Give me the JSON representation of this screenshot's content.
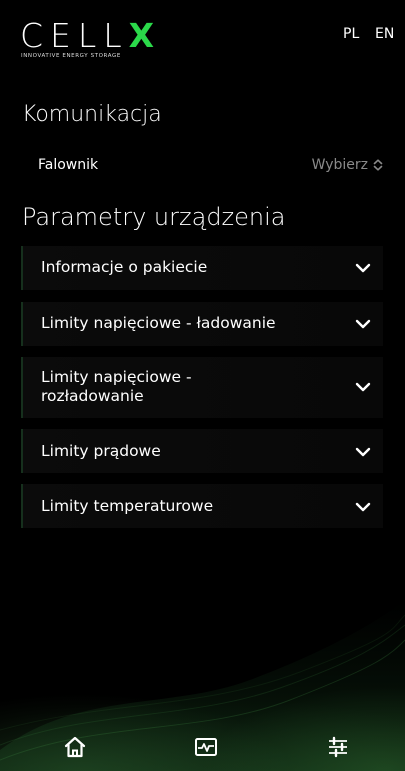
{
  "brand": {
    "logo_text": "CELLX",
    "tagline": "INNOVATIVE ENERGY STORAGE",
    "accent_color": "#2bd94a"
  },
  "header": {
    "languages": [
      "PL",
      "EN"
    ]
  },
  "communication": {
    "title": "Komunikacja",
    "inverter_label": "Falownik",
    "inverter_select": "Wybierz",
    "select_icon": "up-down-chevron-icon"
  },
  "device_params": {
    "title": "Parametry urządzenia",
    "items": [
      {
        "label": "Informacje o pakiecie"
      },
      {
        "label": "Limity napięciowe - ładowanie"
      },
      {
        "label": "Limity napięciowe - rozładowanie"
      },
      {
        "label": "Limity prądowe"
      },
      {
        "label": "Limity temperaturowe"
      }
    ],
    "expand_icon": "chevron-down-icon"
  },
  "bottom_nav": [
    {
      "name": "home",
      "icon": "home-icon"
    },
    {
      "name": "monitor",
      "icon": "activity-monitor-icon"
    },
    {
      "name": "settings",
      "icon": "sliders-icon"
    }
  ]
}
